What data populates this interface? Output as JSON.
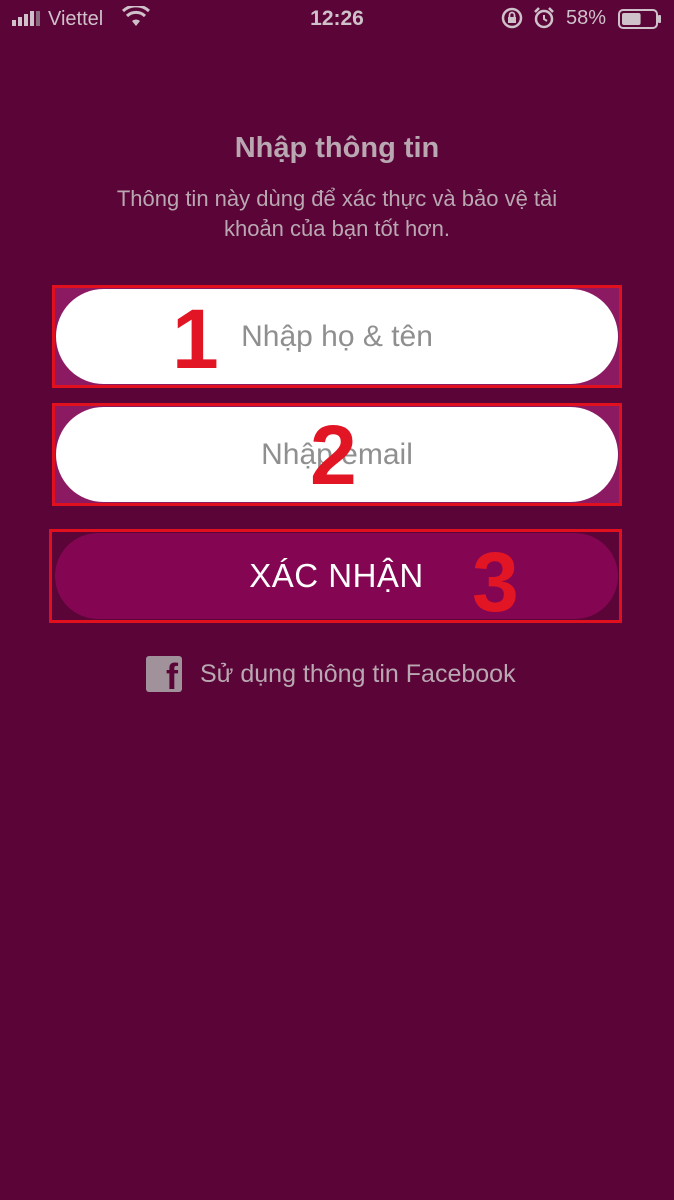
{
  "status_bar": {
    "carrier": "Viettel",
    "time": "12:26",
    "battery": "58%",
    "battery_level": 0.58,
    "icons": [
      "signal-icon",
      "wifi-icon",
      "rotation-lock-icon",
      "alarm-icon",
      "battery-icon"
    ]
  },
  "screen": {
    "title": "Nhập thông tin",
    "subtitle": "Thông tin này dùng để xác thực và bảo vệ tài khoản của bạn tốt hơn."
  },
  "form": {
    "name_placeholder": "Nhập họ & tên",
    "name_value": "",
    "email_placeholder": "Nhập email",
    "email_value": "",
    "confirm_label": "XÁC NHẬN"
  },
  "facebook": {
    "icon": "facebook-icon",
    "label": "Sử dụng thông tin Facebook"
  },
  "annotations": {
    "step1": "1",
    "step2": "2",
    "step3": "3",
    "color": "#e21525"
  },
  "colors": {
    "background": "#5a0437",
    "button": "#840652",
    "muted_text": "#b9a8b2"
  }
}
